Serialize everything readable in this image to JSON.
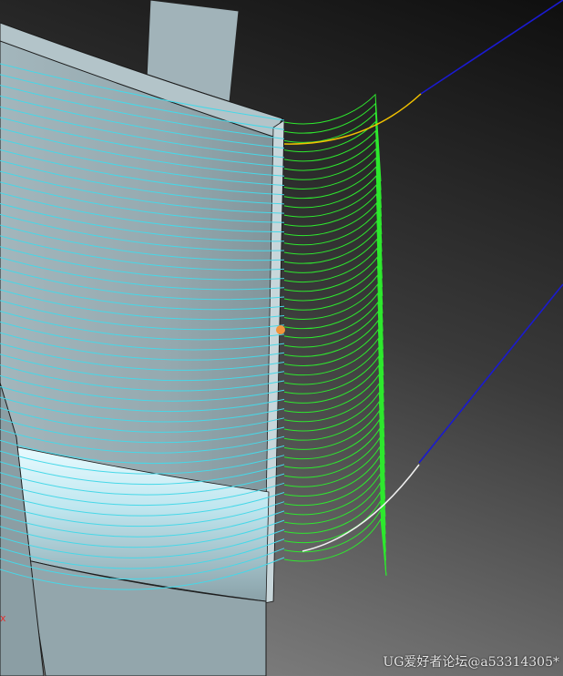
{
  "viewport": {
    "watermark": "UG爱好者论坛@a53314305*",
    "axis_glyph": "x"
  },
  "colors": {
    "background_dark": "#0f0f0f",
    "background_light": "#8a8a8a",
    "blade_surface": "#9aaeb4",
    "blade_shadow": "#7d9097",
    "cutting_toolpath": "#46d8e8",
    "engage_retract_toolpath": "#2ee82e",
    "approach_arc": "#f0c000",
    "departure_arc": "#f0f0f0",
    "rapid_move": "#1a1ad0",
    "start_point": "#f0943c",
    "axis_mark": "#e03030"
  },
  "icons": [
    "start-point-icon"
  ]
}
